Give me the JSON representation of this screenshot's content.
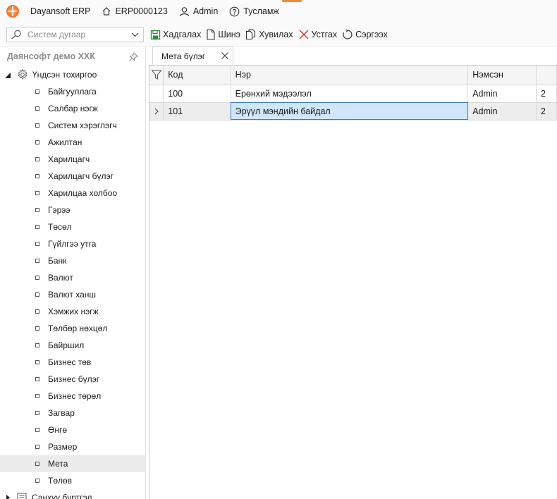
{
  "titlebar": {
    "app_name": "Dayansoft ERP",
    "home_code": "ERP0000123",
    "user": "Admin",
    "help": "Тусламж"
  },
  "toolbar": {
    "search_placeholder": "Систем дугаар",
    "save_label": "Хадгалах",
    "new_label": "Шинэ",
    "copy_label": "Хувилах",
    "delete_label": "Устгах",
    "refresh_label": "Сэргээх"
  },
  "sidebar": {
    "company": "Даянсофт демо ХХК",
    "root_label": "Үндсэн тохиргоо",
    "items": [
      {
        "label": "Байгууллага"
      },
      {
        "label": "Салбар нэгж"
      },
      {
        "label": "Систем хэрэглэгч"
      },
      {
        "label": "Ажилтан"
      },
      {
        "label": "Харилцагч"
      },
      {
        "label": "Харилцагч бүлэг"
      },
      {
        "label": "Харилцаа холбоо"
      },
      {
        "label": "Гэрээ"
      },
      {
        "label": "Төсөл"
      },
      {
        "label": "Гүйлгээ утга"
      },
      {
        "label": "Банк"
      },
      {
        "label": "Валют"
      },
      {
        "label": "Валют ханш"
      },
      {
        "label": "Хэмжих нэгж"
      },
      {
        "label": "Төлбөр нөхцөл"
      },
      {
        "label": "Байршил"
      },
      {
        "label": "Бизнес төв"
      },
      {
        "label": "Бизнес бүлэг"
      },
      {
        "label": "Бизнес төрөл"
      },
      {
        "label": "Загвар"
      },
      {
        "label": "Өнгө"
      },
      {
        "label": "Размер"
      },
      {
        "label": "Мета"
      },
      {
        "label": "Төлөв"
      }
    ],
    "selected_item": "Мета",
    "next_root_label": "Санхүү бүртгэл"
  },
  "tab": {
    "label": "Мета бүлэг"
  },
  "grid": {
    "columns": [
      "Код",
      "Нэр",
      "Нэмсэн",
      ""
    ],
    "rows": [
      {
        "code": "100",
        "name": "Ерөнхий мэдээлэл",
        "added": "Admin",
        "extra": "2"
      },
      {
        "code": "101",
        "name": "Эрүүл мэндийн байдал",
        "added": "Admin",
        "extra": "2"
      }
    ]
  },
  "colors": {
    "accent": "#f08a3b",
    "selection": "#cfe6fb",
    "selection_border": "#3a7cc7",
    "save_icon": "#2e8b3a",
    "delete_icon": "#d93025"
  },
  "icons": [
    "app-logo-icon",
    "home-icon",
    "user-icon",
    "help-icon",
    "search-icon",
    "chevron-down-icon",
    "save-icon",
    "new-document-icon",
    "copy-icon",
    "delete-icon",
    "refresh-icon",
    "pin-icon",
    "gear-icon",
    "folder-icon",
    "close-icon",
    "filter-icon",
    "row-pointer-icon"
  ]
}
